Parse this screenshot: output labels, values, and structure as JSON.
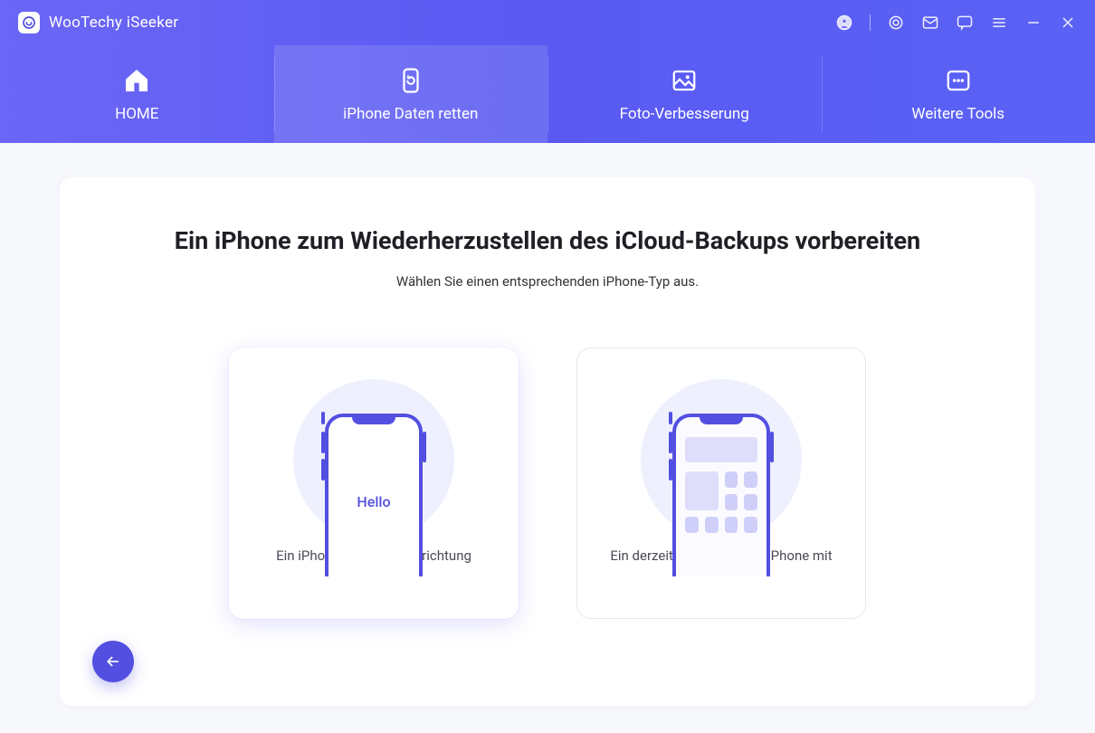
{
  "app": {
    "title": "WooTechy iSeeker"
  },
  "titlebar_icons": {
    "profile": "profile-icon",
    "target": "target-icon",
    "mail": "mail-icon",
    "comment": "comment-icon",
    "menu": "menu-icon",
    "minimize": "minimize-icon",
    "close": "close-icon"
  },
  "nav": {
    "home": "HOME",
    "recover": "iPhone Daten retten",
    "photo": "Foto-Verbesserung",
    "more": "Weitere Tools",
    "active_index": 1
  },
  "main": {
    "heading": "Ein iPhone zum Wiederherzustellen des iCloud-Backups vorbereiten",
    "subtitle": "Wählen Sie einen entsprechenden iPhone-Typ aus.",
    "card1": {
      "hello_text": "Hello",
      "label": "Ein iPhone in der Ersteinrichtung"
    },
    "card2": {
      "label": "Ein derzeit verwendendes iPhone mit Daten"
    }
  },
  "colors": {
    "accent": "#524fe1",
    "gradient_from": "#6b66f5",
    "gradient_to": "#5a62f5"
  }
}
